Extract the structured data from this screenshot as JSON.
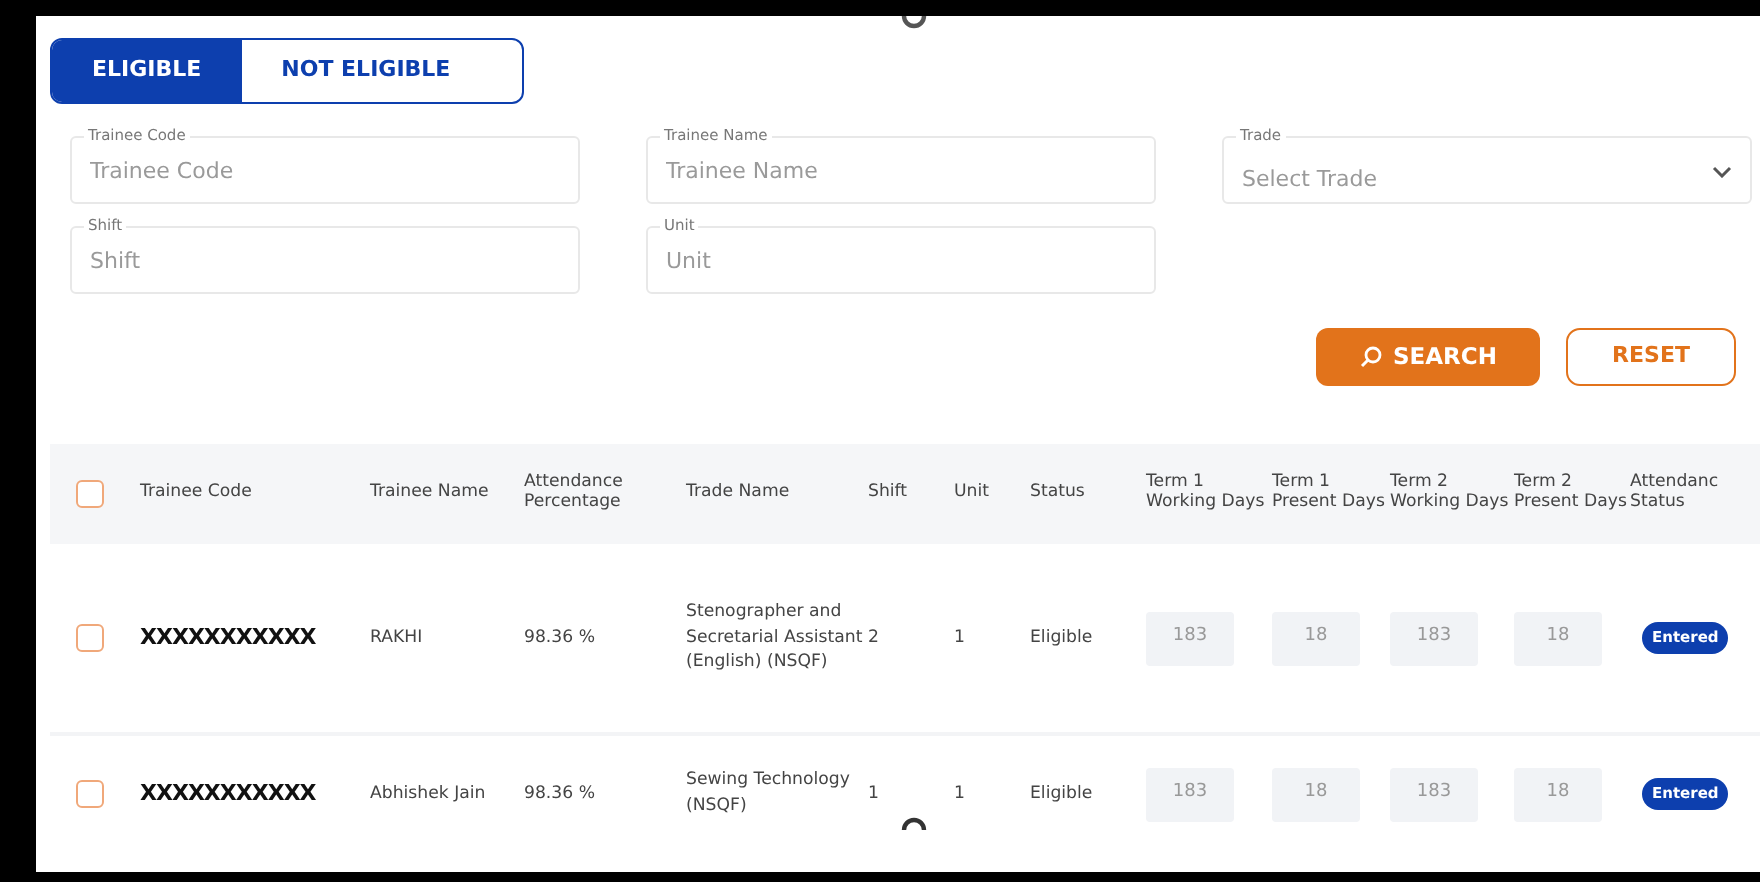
{
  "tabs": [
    {
      "label": "ELIGIBLE",
      "selected": true
    },
    {
      "label": "NOT ELIGIBLE",
      "selected": false
    }
  ],
  "filters": [
    {
      "label": "Trainee Code",
      "placeholder": "Trainee Code",
      "kind": "text"
    },
    {
      "label": "Trainee Name",
      "placeholder": "Trainee Name",
      "kind": "text"
    },
    {
      "label": "Trade",
      "placeholder": "Select Trade",
      "kind": "select"
    },
    {
      "label": "Shift",
      "placeholder": "Shift",
      "kind": "text"
    },
    {
      "label": "Unit",
      "placeholder": "Unit",
      "kind": "text"
    }
  ],
  "buttons": {
    "search": "SEARCH",
    "reset": "RESET"
  },
  "table": {
    "select_all_checked": false,
    "columns": [
      "Trainee Code",
      "Trainee Name",
      "Attendance Percentage",
      "Trade Name",
      "Shift",
      "Unit",
      "Status",
      "Term 1 Working Days",
      "Term 1 Present Days",
      "Term 2 Working Days",
      "Term 2 Present Days",
      "Attendanc Status"
    ],
    "rows": [
      {
        "checked": false,
        "code": "XXXXXXXXXXX",
        "name": "RAKHI",
        "attendance": "98.36 %",
        "trade": "Stenographer and Secretarial Assistant (English) (NSQF)",
        "shift": "2",
        "unit": "1",
        "status": "Eligible",
        "days": [
          "183",
          "18",
          "183",
          "18"
        ],
        "attendance_status": "Entered"
      },
      {
        "checked": false,
        "code": "XXXXXXXXXXX",
        "name": "Abhishek Jain",
        "attendance": "98.36 %",
        "trade": "Sewing Technology (NSQF)",
        "shift": "1",
        "unit": "1",
        "status": "Eligible",
        "days": [
          "183",
          "18",
          "183",
          "18"
        ],
        "attendance_status": "Entered"
      }
    ]
  }
}
